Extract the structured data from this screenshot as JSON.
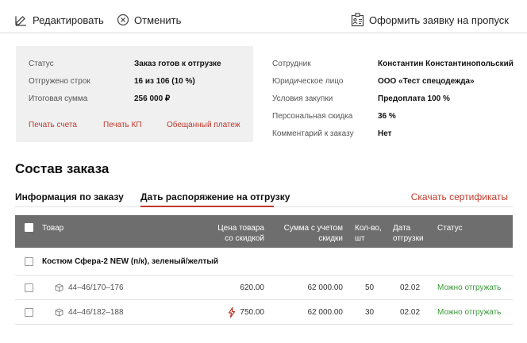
{
  "toolbar": {
    "edit_label": "Редактировать",
    "cancel_label": "Отменить",
    "permit_label": "Оформить заявку на пропуск"
  },
  "order_summary": {
    "status_label": "Статус",
    "status_value": "Заказ готов к отгрузке",
    "shipped_label": "Отгружено строк",
    "shipped_value": "16 из 106 (10 %)",
    "total_label": "Итоговая сумма",
    "total_value": "256 000 ₽",
    "links": {
      "print_invoice": "Печать счета",
      "print_offer": "Печать КП",
      "promised_payment": "Обещанный платеж"
    }
  },
  "client_info": {
    "employee_label": "Сотрудник",
    "employee_value": "Константин Константинопольский",
    "entity_label": "Юридическое лицо",
    "entity_value": "ООО «Тест спецодежда»",
    "terms_label": "Условия закупки",
    "terms_value": "Предоплата 100 %",
    "discount_label": "Персональная скидка",
    "discount_value": "36 %",
    "comment_label": "Комментарий к заказу",
    "comment_value": "Нет"
  },
  "section": {
    "title": "Состав заказа"
  },
  "tabs": {
    "info": "Информация по заказу",
    "shipment": "Дать распоряжение на отгрузку",
    "download_certs": "Скачать сертификаты"
  },
  "table": {
    "headers": {
      "product": "Товар",
      "price_line1": "Цена товара",
      "price_line2": "со скидкой",
      "sum_line1": "Сумма с учетом",
      "sum_line2": "скидки",
      "qty_line1": "Кол-во,",
      "qty_line2": "шт",
      "date_line1": "Дата",
      "date_line2": "отгрузки",
      "status": "Статус"
    },
    "group_name": "Костюм Сфера-2 NEW (п/к), зеленый/желтый",
    "rows": [
      {
        "size": "44–46/170–176",
        "price": "620.00",
        "sum": "62 000.00",
        "qty": "50",
        "date": "02.02",
        "status": "Можно отгружать"
      },
      {
        "size": "44–46/182–188",
        "price": "750.00",
        "sum": "62 000.00",
        "qty": "30",
        "date": "02.02",
        "status": "Можно отгружать"
      }
    ]
  },
  "colors": {
    "accent": "#c0392b",
    "header_bg": "#6e6e6e",
    "ok": "#3a9a3a",
    "panel_bg": "#f0f0f0"
  }
}
